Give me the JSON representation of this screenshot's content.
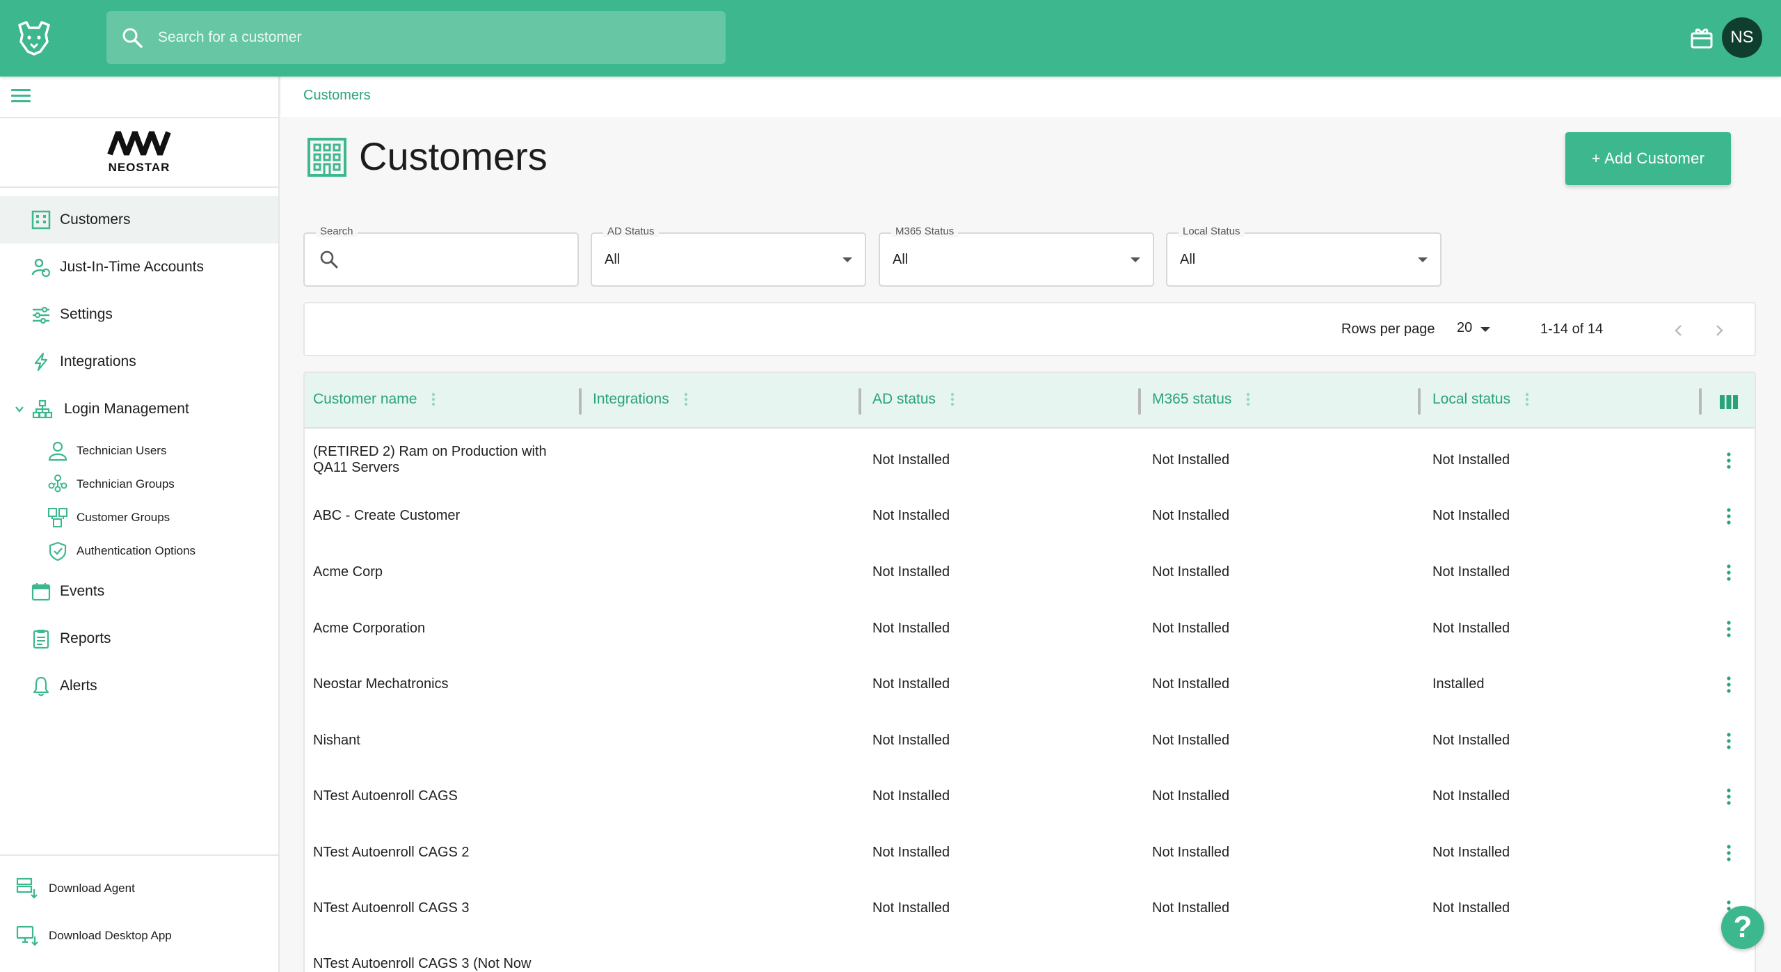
{
  "header": {
    "search_placeholder": "Search for a customer",
    "avatar_initials": "NS"
  },
  "sidebar": {
    "brand": "NEOSTAR",
    "items": [
      {
        "label": "Customers",
        "icon": "building-icon",
        "active": true
      },
      {
        "label": "Just-In-Time Accounts",
        "icon": "user-clock-icon"
      },
      {
        "label": "Settings",
        "icon": "sliders-icon"
      },
      {
        "label": "Integrations",
        "icon": "lightning-icon"
      },
      {
        "label": "Login Management",
        "icon": "hierarchy-icon",
        "expanded": true
      },
      {
        "label": "Events",
        "icon": "calendar-icon"
      },
      {
        "label": "Reports",
        "icon": "clipboard-icon"
      },
      {
        "label": "Alerts",
        "icon": "bell-icon"
      }
    ],
    "sub_items": [
      {
        "label": "Technician Users",
        "icon": "user-icon"
      },
      {
        "label": "Technician Groups",
        "icon": "users-group-icon"
      },
      {
        "label": "Customer Groups",
        "icon": "buildings-group-icon"
      },
      {
        "label": "Authentication Options",
        "icon": "shield-check-icon"
      }
    ],
    "downloads": [
      {
        "label": "Download Agent",
        "icon": "server-download-icon"
      },
      {
        "label": "Download Desktop App",
        "icon": "monitor-download-icon"
      }
    ]
  },
  "breadcrumb": "Customers",
  "page": {
    "title": "Customers",
    "add_button": "+ Add Customer"
  },
  "filters": {
    "search_label": "Search",
    "search_value": "",
    "ad_label": "AD Status",
    "ad_value": "All",
    "m365_label": "M365 Status",
    "m365_value": "All",
    "local_label": "Local Status",
    "local_value": "All"
  },
  "pager": {
    "rows_per_page_label": "Rows per page",
    "rows_per_page": "20",
    "range": "1-14 of 14"
  },
  "table": {
    "columns": [
      "Customer name",
      "Integrations",
      "AD status",
      "M365 status",
      "Local status"
    ],
    "rows": [
      {
        "name": "(RETIRED 2) Ram on Production with QA11 Servers",
        "integrations": "",
        "ad": "Not Installed",
        "m365": "Not Installed",
        "local": "Not Installed"
      },
      {
        "name": "ABC - Create Customer",
        "integrations": "",
        "ad": "Not Installed",
        "m365": "Not Installed",
        "local": "Not Installed"
      },
      {
        "name": "Acme Corp",
        "integrations": "",
        "ad": "Not Installed",
        "m365": "Not Installed",
        "local": "Not Installed"
      },
      {
        "name": "Acme Corporation",
        "integrations": "",
        "ad": "Not Installed",
        "m365": "Not Installed",
        "local": "Not Installed"
      },
      {
        "name": "Neostar Mechatronics",
        "integrations": "",
        "ad": "Not Installed",
        "m365": "Not Installed",
        "local": "Installed"
      },
      {
        "name": "Nishant",
        "integrations": "",
        "ad": "Not Installed",
        "m365": "Not Installed",
        "local": "Not Installed"
      },
      {
        "name": "NTest Autoenroll CAGS",
        "integrations": "",
        "ad": "Not Installed",
        "m365": "Not Installed",
        "local": "Not Installed"
      },
      {
        "name": "NTest Autoenroll CAGS 2",
        "integrations": "",
        "ad": "Not Installed",
        "m365": "Not Installed",
        "local": "Not Installed"
      },
      {
        "name": "NTest Autoenroll CAGS 3",
        "integrations": "",
        "ad": "Not Installed",
        "m365": "Not Installed",
        "local": "Not Installed"
      },
      {
        "name": "NTest Autoenroll CAGS 3 (Not Now",
        "integrations": "",
        "ad": "",
        "m365": "",
        "local": ""
      }
    ]
  },
  "help_label": "?",
  "colors": {
    "brand": "#3db78d",
    "brand_dark": "#2aa37b",
    "header_row": "#e6f5ef"
  }
}
